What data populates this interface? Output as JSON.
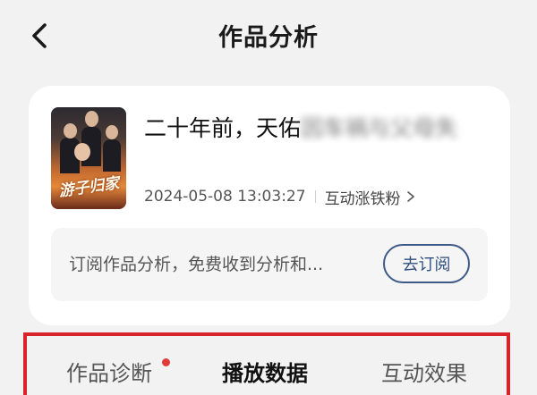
{
  "header": {
    "title": "作品分析",
    "back_icon": "chevron-left-icon"
  },
  "video": {
    "title_visible": "二十年前，天佑",
    "title_blurred": "因车祸与父母失",
    "poster_logo": "游子归家",
    "publish_time": "2024-05-08 13:03:27",
    "activity_label": "互动涨铁粉",
    "activity_icon": "chevron-right-icon"
  },
  "subscribe": {
    "text": "订阅作品分析，免费收到分析和...",
    "button_label": "去订阅"
  },
  "tabs": [
    {
      "label": "作品诊断",
      "active": false,
      "has_dot": true
    },
    {
      "label": "播放数据",
      "active": true,
      "has_dot": false
    },
    {
      "label": "互动效果",
      "active": false,
      "has_dot": false
    }
  ],
  "colors": {
    "highlight_border": "#d8232a",
    "badge_dot": "#e23a3a",
    "subscribe_accent": "#3d5a86",
    "page_background": "#f2f2f2"
  }
}
